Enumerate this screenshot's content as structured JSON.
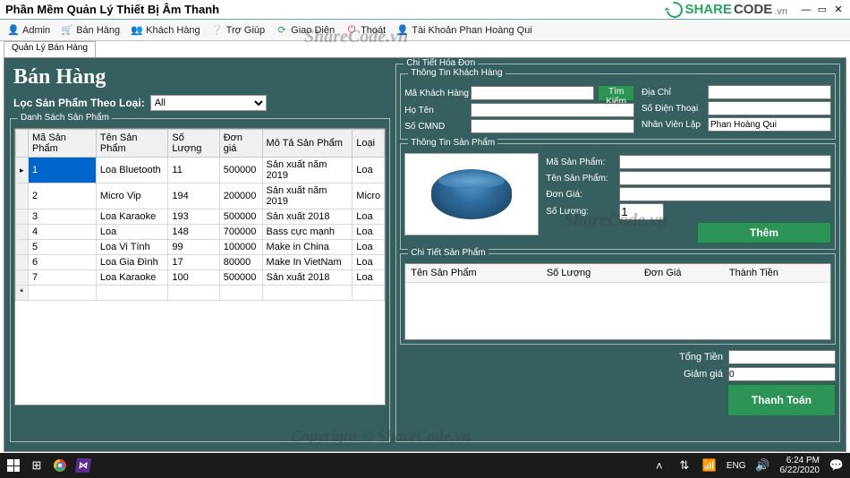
{
  "window": {
    "title": "Phần Mềm Quản Lý Thiết Bị Âm Thanh"
  },
  "branding": {
    "part1": "SHARE",
    "part2": "CODE",
    "part3": ".vn"
  },
  "watermark": {
    "text": "ShareCode.vn",
    "copyright": "Copyright © ShareCode.vn"
  },
  "menu": {
    "admin": "Admin",
    "banhang": "Bán Hàng",
    "khachhang": "Khách Hàng",
    "trogiup": "Trợ Giúp",
    "giaodien": "Giao Diện",
    "thoat": "Thoát",
    "account": "Tài Khoản Phan Hoàng Qui"
  },
  "tab": {
    "label": "Quản Lý Bán Hàng"
  },
  "page": {
    "heading": "Bán Hàng",
    "filter_label": "Lọc Sản Phẩm Theo Loại:",
    "filter_value": "All"
  },
  "list_box": {
    "legend": "Danh Sách Sản Phẩm",
    "cols": {
      "ma": "Mã Sản Phẩm",
      "ten": "Tên Sản Phẩm",
      "sl": "Số Lượng",
      "gia": "Đơn giá",
      "mota": "Mô Tả Sản Phẩm",
      "loai": "Loại"
    },
    "rows": [
      {
        "ma": "1",
        "ten": "Loa Bluetooth",
        "sl": "11",
        "gia": "500000",
        "mota": "Sản xuất năm 2019",
        "loai": "Loa"
      },
      {
        "ma": "2",
        "ten": "Micro Vip",
        "sl": "194",
        "gia": "200000",
        "mota": "Sản xuất năm 2019",
        "loai": "Micro"
      },
      {
        "ma": "3",
        "ten": "Loa Karaoke",
        "sl": "193",
        "gia": "500000",
        "mota": "Sản xuất 2018",
        "loai": "Loa"
      },
      {
        "ma": "4",
        "ten": "Loa",
        "sl": "148",
        "gia": "700000",
        "mota": "Bass cực mạnh",
        "loai": "Loa"
      },
      {
        "ma": "5",
        "ten": "Loa Vi Tính",
        "sl": "99",
        "gia": "100000",
        "mota": "Make in China",
        "loai": "Loa"
      },
      {
        "ma": "6",
        "ten": "Loa Gia Đình",
        "sl": "17",
        "gia": "80000",
        "mota": "Make In VietNam",
        "loai": "Loa"
      },
      {
        "ma": "7",
        "ten": "Loa Karaoke",
        "sl": "100",
        "gia": "500000",
        "mota": "Sản xuất 2018",
        "loai": "Loa"
      }
    ]
  },
  "invoice": {
    "legend": "Chi Tiết Hóa Đơn",
    "customer": {
      "legend": "Thông Tin Khách Hàng",
      "labels": {
        "makh": "Mã Khách Hàng",
        "hoten": "Họ Tên",
        "cmnd": "Số CMND",
        "diachi": "Địa Chỉ",
        "sdt": "Số Điện Thoại",
        "nvlap": "Nhân Viên Lập"
      },
      "values": {
        "makh": "",
        "hoten": "",
        "cmnd": "",
        "diachi": "",
        "sdt": "",
        "nvlap": "Phan Hoàng Qui"
      },
      "search_btn": "Tìm Kiếm"
    },
    "product": {
      "legend": "Thông Tin Sản Phẩm",
      "labels": {
        "masp": "Mã Sản Phẩm:",
        "tensp": "Tên Sản Phẩm:",
        "gia": "Đơn Giá:",
        "sl": "Số Lượng:"
      },
      "values": {
        "masp": "",
        "tensp": "",
        "gia": "",
        "sl": "1"
      },
      "add_btn": "Thêm"
    },
    "detail": {
      "legend": "Chi Tiết Sản Phẩm",
      "cols": {
        "tensp": "Tên Sản Phẩm",
        "sl": "Số Lượng",
        "gia": "Đơn Giá",
        "tien": "Thành Tiền"
      }
    },
    "totals": {
      "tong_label": "Tổng Tiền",
      "giam_label": "Giảm giá",
      "tong": "",
      "giam": "0",
      "pay_btn": "Thanh Toán"
    }
  },
  "taskbar": {
    "lang": "ENG",
    "time": "6:24 PM",
    "date": "6/22/2020"
  }
}
